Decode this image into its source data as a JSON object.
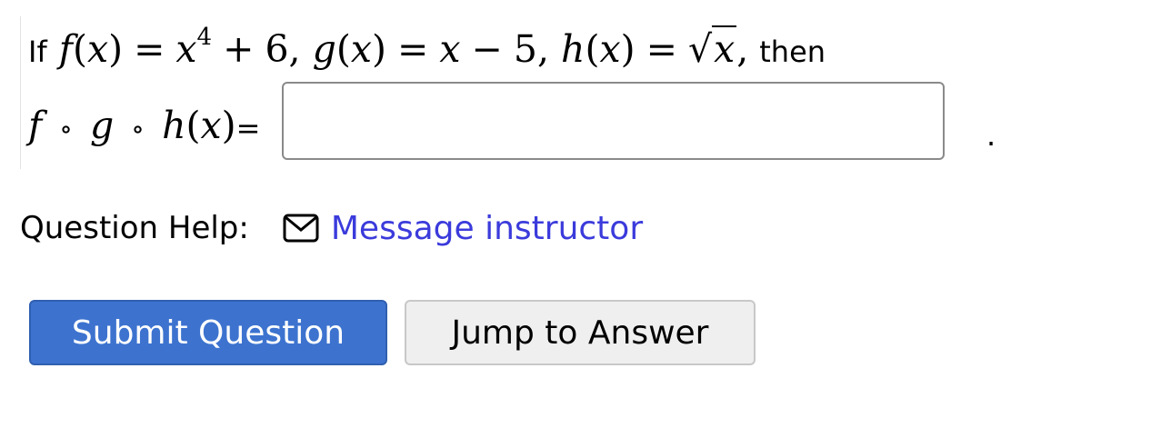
{
  "question": {
    "prefix": "If",
    "suffix": "then",
    "f_def": {
      "name": "f",
      "var": "x",
      "base": "x",
      "exp": "4",
      "op": "+",
      "const": "6"
    },
    "g_def": {
      "name": "g",
      "var": "x",
      "left": "x",
      "op": "−",
      "const": "5"
    },
    "h_def": {
      "name": "h",
      "var": "x",
      "radicand": "x"
    },
    "composition": {
      "f": "f",
      "g": "g",
      "h": "h",
      "compose_op": "∘",
      "var": "x",
      "equals": "="
    },
    "answer": {
      "value": "",
      "placeholder": ""
    },
    "trailing_period": "."
  },
  "help": {
    "label": "Question Help:",
    "icon": "mail-icon",
    "link_text": "Message instructor",
    "link_color": "#3b3bdc"
  },
  "buttons": {
    "submit_label": "Submit Question",
    "jump_label": "Jump to Answer",
    "submit_color": "#3d73cf"
  }
}
